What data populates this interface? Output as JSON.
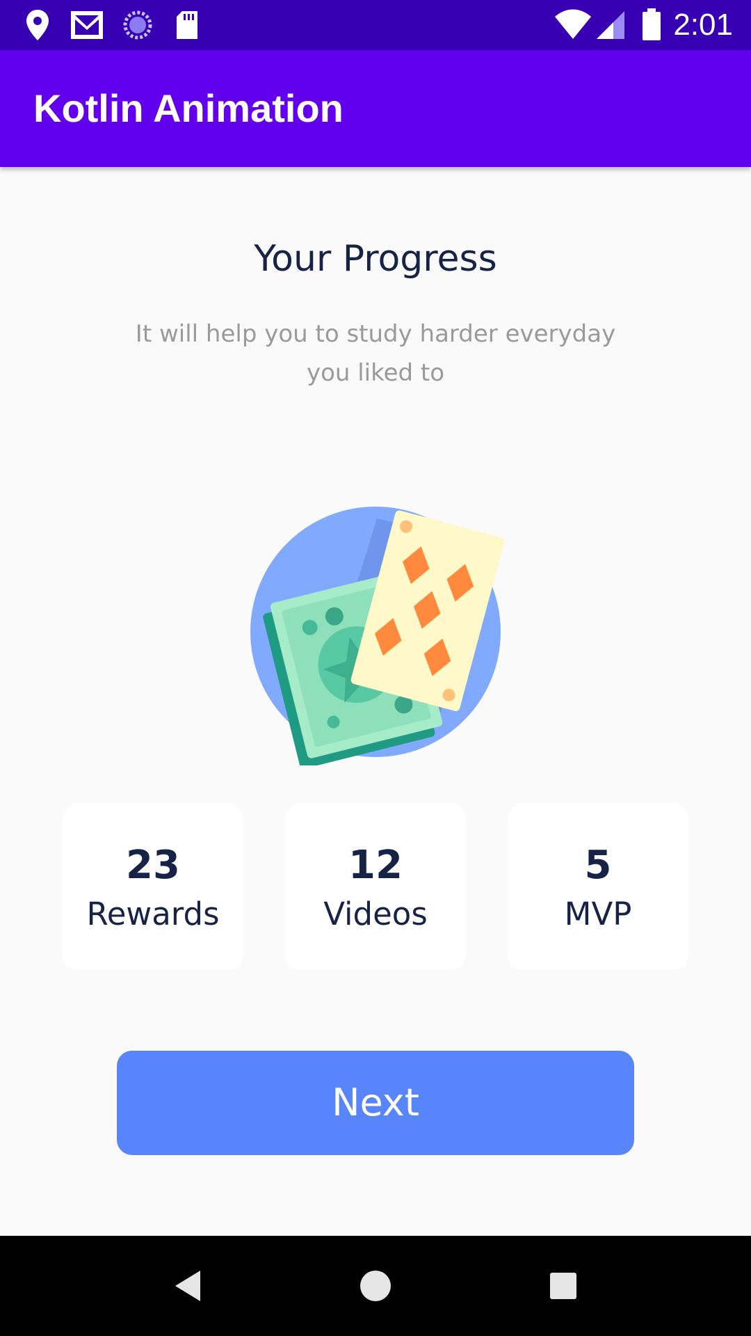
{
  "status_bar": {
    "time": "2:01",
    "icons": [
      "location-pin-icon",
      "gmail-icon",
      "sync-icon",
      "sd-card-icon",
      "wifi-icon",
      "signal-icon",
      "battery-icon"
    ]
  },
  "app_bar": {
    "title": "Kotlin Animation"
  },
  "main": {
    "title": "Your Progress",
    "subtitle": "It will help you to study harder everyday you liked to",
    "illustration": "playing-cards-and-money-illustration",
    "stats": [
      {
        "value": "23",
        "label": "Rewards"
      },
      {
        "value": "12",
        "label": "Videos"
      },
      {
        "value": "5",
        "label": "MVP"
      }
    ],
    "next_button_label": "Next"
  },
  "nav_bar": {
    "buttons": [
      "back-icon",
      "home-icon",
      "recents-icon"
    ]
  },
  "colors": {
    "status_bar": "#3700b3",
    "app_bar": "#6200ee",
    "background": "#fafafa",
    "heading_text": "#172346",
    "subtitle_text": "#9a9a9a",
    "button": "#5885f9",
    "circle": "#82aafc",
    "money": "#5ec8a2",
    "card": "#fff8c8",
    "card_suit": "#ff8a3d"
  }
}
